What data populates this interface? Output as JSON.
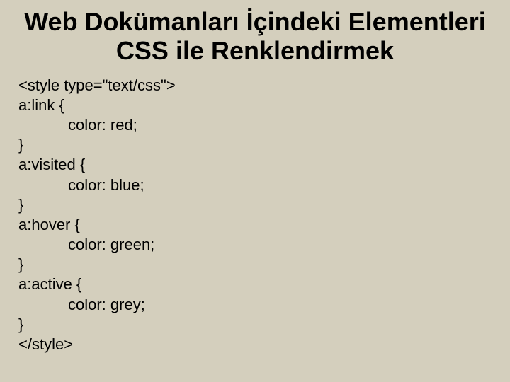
{
  "title": "Web Dokümanları İçindeki Elementleri CSS ile Renklendirmek",
  "code": {
    "l01": "<style type=\"text/css\">",
    "l02": "a:link {",
    "l03": "color: red;",
    "l04": "}",
    "l05": "a:visited {",
    "l06": "color: blue;",
    "l07": "}",
    "l08": "a:hover {",
    "l09": "color: green;",
    "l10": "}",
    "l11": "a:active {",
    "l12": "color: grey;",
    "l13": "}",
    "l14": "</style>"
  }
}
